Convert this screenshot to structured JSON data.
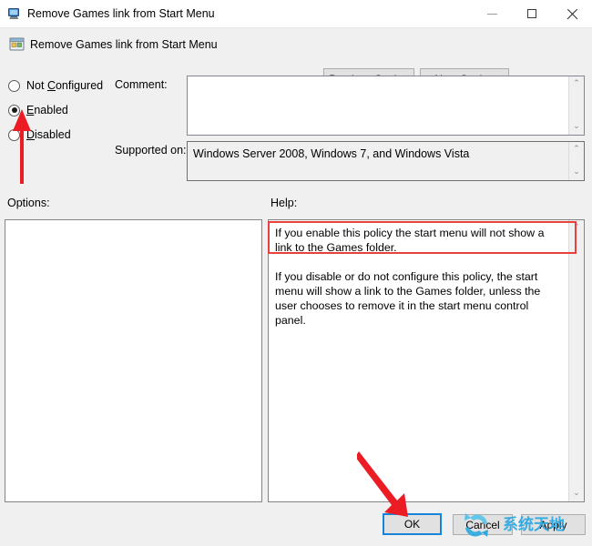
{
  "window": {
    "title": "Remove Games link from Start Menu",
    "icon": "monitor-policy-icon",
    "controls": {
      "minimize": "minimize-icon",
      "maximize": "maximize-icon",
      "close": "close-icon"
    }
  },
  "header": {
    "title": "Remove Games link from Start Menu",
    "icon": "policy-setting-icon",
    "previous_setting": "Previous Setting",
    "previous_mnemonic": "P",
    "next_setting": "Next Setting",
    "next_mnemonic": "N"
  },
  "state_options": [
    {
      "label": "Not Configured",
      "mnemonic": "C",
      "pre": "Not ",
      "post": "onfigured",
      "checked": false
    },
    {
      "label": "Enabled",
      "mnemonic": "E",
      "pre": "",
      "post": "nabled",
      "checked": true
    },
    {
      "label": "Disabled",
      "mnemonic": "D",
      "pre": "",
      "post": "isabled",
      "checked": false
    }
  ],
  "fields": {
    "comment_label": "Comment:",
    "comment_value": "",
    "supported_label": "Supported on:",
    "supported_value": "Windows Server 2008, Windows 7, and Windows Vista"
  },
  "panes": {
    "options_label": "Options:",
    "options_value": "",
    "help_label": "Help:",
    "help_paragraphs": [
      "If you enable this policy the start menu will not show a link to the Games folder.",
      "If you disable or do not configure this policy, the start menu will show a link to the Games folder, unless the user chooses to remove it in the start menu control panel."
    ]
  },
  "scrollbars": {
    "up_arrow": "⌃",
    "down_arrow": "⌄"
  },
  "buttons": {
    "ok": "OK",
    "cancel": "Cancel",
    "apply": "Apply"
  },
  "annotations": {
    "arrow_enabled": "red-arrow-up",
    "arrow_ok": "red-arrow-diagonal",
    "highlight_help": "red-highlight-box",
    "accent_red": "#e8403a",
    "focus_blue": "#1883d7"
  },
  "watermark": {
    "text": "系统天地",
    "color": "#2aa8e0",
    "logo": "refresh-arrows-icon"
  }
}
